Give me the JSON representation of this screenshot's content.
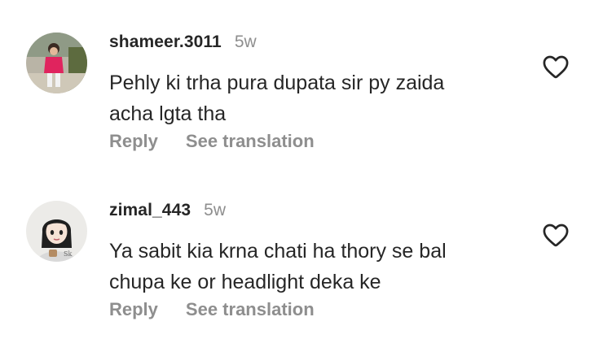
{
  "comments": [
    {
      "username": "shameer.3011",
      "time": "5w",
      "text_lines": [
        "Pehly ki trha pura dupata sir py zaida",
        "acha lgta tha"
      ],
      "reply_label": "Reply",
      "translate_label": "See translation",
      "avatar": "photo-avatar-child-pink",
      "like_icon": "heart-outline-icon"
    },
    {
      "username": "zimal_443",
      "time": "5w",
      "text_lines": [
        "Ya sabit kia krna chati ha thory se bal",
        "chupa ke or headlight deka ke"
      ],
      "reply_label": "Reply",
      "translate_label": "See translation",
      "avatar": "cartoon-avatar-girl",
      "like_icon": "heart-outline-icon"
    }
  ],
  "colors": {
    "text": "#262626",
    "secondary": "#8e8e8e",
    "background": "#ffffff"
  }
}
